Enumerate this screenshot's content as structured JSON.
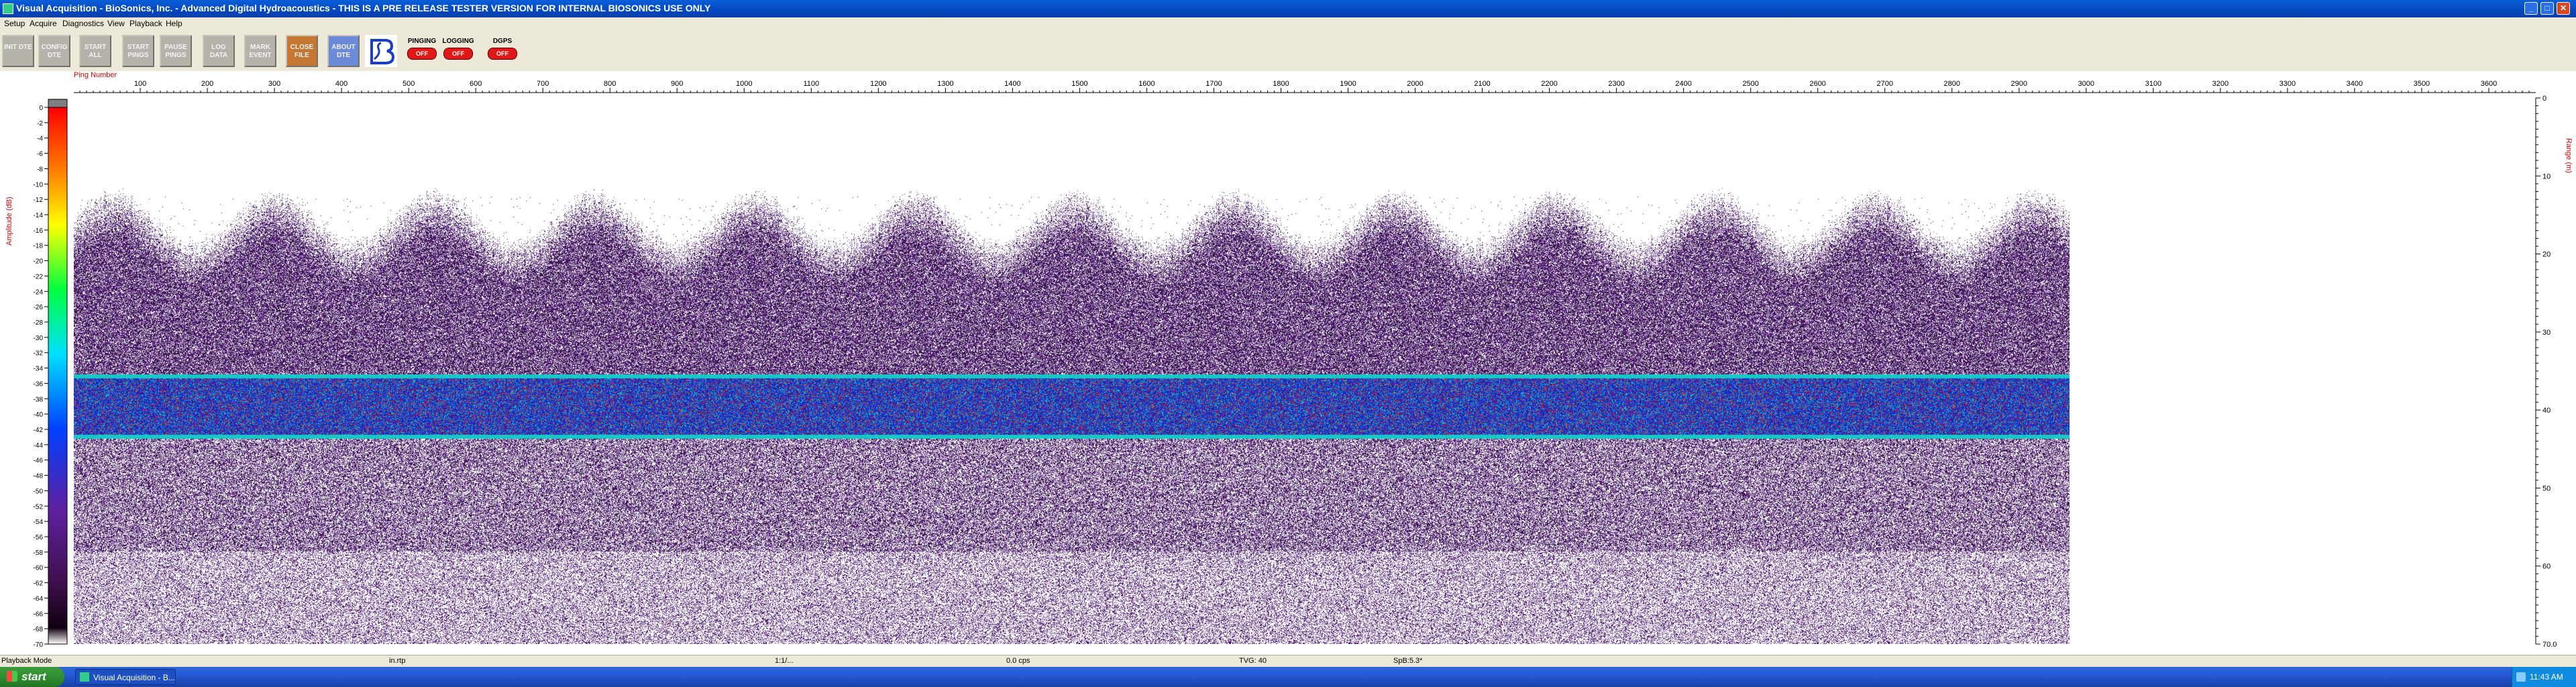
{
  "window": {
    "title": "Visual Acquisition  -  BioSonics, Inc.  -  Advanced Digital Hydroacoustics  -  THIS IS A PRE RELEASE TESTER VERSION FOR INTERNAL BIOSONICS USE ONLY",
    "app_icon": "app-icon",
    "min_glyph": "_",
    "max_glyph": "□",
    "close_glyph": "✕"
  },
  "menu": [
    "Setup",
    "Acquire",
    "Diagnostics",
    "View",
    "Playback",
    "Help"
  ],
  "toolbar": {
    "buttons": [
      {
        "name": "init-dte-button",
        "label": "INIT DTE"
      },
      {
        "name": "config-dte-button",
        "label": "CONFIG DTE"
      },
      {
        "name": "start-all-button",
        "label": "START ALL"
      },
      {
        "name": "start-pings-button",
        "label": "START PINGS"
      },
      {
        "name": "pause-pings-button",
        "label": "PAUSE PINGS"
      },
      {
        "name": "log-data-button",
        "label": "LOG DATA"
      },
      {
        "name": "mark-event-button",
        "label": "MARK EVENT"
      },
      {
        "name": "close-file-button",
        "label": "CLOSE FILE"
      },
      {
        "name": "about-dte-button",
        "label": "ABOUT DTE"
      }
    ],
    "logo_icon": "biosonics-logo",
    "status_buttons": [
      {
        "name": "pinging-status",
        "label": "PINGING",
        "state": "OFF"
      },
      {
        "name": "logging-status",
        "label": "LOGGING",
        "state": "OFF"
      },
      {
        "name": "dgps-status",
        "label": "DGPS",
        "state": "OFF"
      }
    ]
  },
  "echogram": {
    "x_axis_label": "Ping Number",
    "x_ticks": [
      100,
      200,
      300,
      400,
      500,
      600,
      700,
      800,
      900,
      1000,
      1100,
      1200,
      1300,
      1400,
      1500,
      1600,
      1700,
      1800,
      1900,
      2000,
      2100,
      2200,
      2300,
      2400,
      2500,
      2600,
      2700,
      2800,
      2900,
      3000,
      3100,
      3200,
      3300,
      3400,
      3500,
      3600
    ],
    "x_range": [
      1,
      3670
    ],
    "pings_recorded": 2975,
    "amplitude_label": "Amplitude (dB)",
    "amplitude_ticks": [
      0,
      -2,
      -4,
      -6,
      -8,
      -10,
      -12,
      -14,
      -16,
      -18,
      -20,
      -22,
      -24,
      -26,
      -28,
      -30,
      -32,
      -34,
      -36,
      -38,
      -40,
      -42,
      -44,
      -46,
      -48,
      -50,
      -52,
      -54,
      -56,
      -58,
      -60,
      -62,
      -64,
      -66,
      -68,
      -70
    ],
    "amplitude_range": [
      0,
      -70
    ],
    "range_label": "Range (m)",
    "range_ticks": [
      0,
      10,
      20,
      30,
      40,
      50,
      60,
      70
    ],
    "range_end_label": "70.0",
    "range_max": 70,
    "colors": {
      "axis_label": "#e00000",
      "noise": "#4a1a6b",
      "layer_core": "#1030d8",
      "layer_edge": "#18c8c8",
      "layer_hot": "#e02020"
    }
  },
  "statusbar": [
    "Playback Mode",
    "in.rtp",
    "1:1/...",
    "0.0 cps",
    "TVG: 40",
    "SpB:5.3*"
  ],
  "taskbar": {
    "start_label": "start",
    "task_label": "Visual Acquisition  -  B...",
    "clock": "11:43 AM"
  }
}
